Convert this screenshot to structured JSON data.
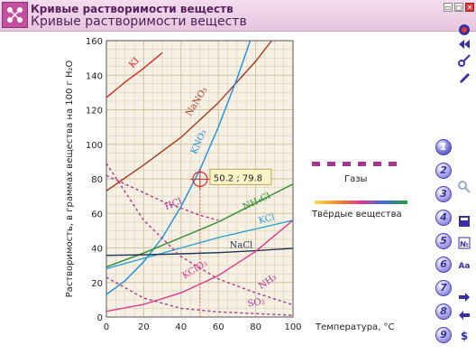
{
  "app": {
    "window_title": "Кривые растворимости веществ",
    "page_title": "Кривые растворимости веществ",
    "window_buttons": [
      "▭",
      "▢",
      "✕"
    ]
  },
  "sidebar": {
    "numbered_buttons": [
      "1",
      "2",
      "3",
      "4",
      "5",
      "6",
      "7",
      "8",
      "9"
    ],
    "active_index": 0,
    "icons": [
      "stop-icon",
      "rewind-icon",
      "key-icon",
      "pencil-icon",
      "magnifier-icon",
      "calculator-icon",
      "number-icon",
      "font-icon",
      "arrow-right-icon",
      "arrow-left-icon",
      "dollar-icon"
    ]
  },
  "colors": {
    "background": "#ffffff",
    "grid_fill": "#f6f1e4",
    "grid_line": "#cfc29c",
    "gas_legend": "#a8358f",
    "accent": "#6a5fcb"
  },
  "chart_data": {
    "type": "line",
    "ylabel": "Растворимость, в граммах вещества на 100 г H₂O",
    "xlabel": "Температура, °C",
    "xlim": [
      0,
      100
    ],
    "ylim": [
      0,
      160
    ],
    "xticks": [
      0,
      20,
      40,
      60,
      80,
      100
    ],
    "yticks": [
      0,
      20,
      40,
      60,
      80,
      100,
      120,
      140,
      160
    ],
    "grid": true,
    "legend": {
      "placement": "right",
      "entries": [
        {
          "label": "Газы",
          "style": "dashed",
          "color": "#a8358f"
        },
        {
          "label": "Твёрдые вещества",
          "style": "gradient",
          "color": "rainbow"
        }
      ]
    },
    "annotation": {
      "text": "50.2 ; 79.8",
      "x": 50.2,
      "y": 79.8
    },
    "series": [
      {
        "name": "KI",
        "color": "#d62828",
        "dash": false,
        "x": [
          0,
          10,
          20,
          30
        ],
        "y": [
          127,
          136,
          144,
          153
        ]
      },
      {
        "name": "NaNO₃",
        "color": "#a23b22",
        "dash": false,
        "x": [
          0,
          20,
          40,
          60,
          80,
          100
        ],
        "y": [
          73,
          88,
          104,
          124,
          148,
          176
        ]
      },
      {
        "name": "KNO₃",
        "color": "#1f8fe0",
        "dash": false,
        "x": [
          0,
          10,
          20,
          30,
          40,
          50,
          60,
          70,
          80
        ],
        "y": [
          13,
          21,
          32,
          46,
          64,
          85,
          110,
          138,
          169
        ]
      },
      {
        "name": "NH₄Cl",
        "color": "#2e8b2e",
        "dash": false,
        "x": [
          0,
          20,
          40,
          60,
          80,
          100
        ],
        "y": [
          29,
          37,
          46,
          55,
          66,
          77
        ]
      },
      {
        "name": "KCl",
        "color": "#2a9fd6",
        "dash": false,
        "x": [
          0,
          20,
          40,
          60,
          80,
          100
        ],
        "y": [
          28,
          34,
          40,
          46,
          51,
          56
        ]
      },
      {
        "name": "NaCl",
        "color": "#1d3557",
        "dash": false,
        "x": [
          0,
          20,
          40,
          60,
          80,
          100
        ],
        "y": [
          35.7,
          36,
          36.6,
          37.3,
          38.4,
          39.8
        ]
      },
      {
        "name": "KClO₃",
        "color": "#e0358b",
        "dash": false,
        "x": [
          0,
          20,
          40,
          60,
          80,
          100
        ],
        "y": [
          3.3,
          7.3,
          14,
          24,
          38,
          56
        ]
      },
      {
        "name": "HCl",
        "color": "#a8358f",
        "dash": true,
        "x": [
          0,
          10,
          20,
          30,
          40,
          50,
          60
        ],
        "y": [
          82,
          77,
          72,
          67,
          63,
          59,
          56
        ]
      },
      {
        "name": "NH₃",
        "color": "#a8358f",
        "dash": true,
        "x": [
          0,
          20,
          40,
          60,
          80,
          100
        ],
        "y": [
          89,
          56,
          35,
          22,
          14,
          7
        ]
      },
      {
        "name": "SO₂",
        "color": "#a8358f",
        "dash": true,
        "x": [
          0,
          20,
          40,
          60,
          80,
          100
        ],
        "y": [
          23,
          11,
          5,
          3,
          2,
          1
        ]
      }
    ]
  }
}
